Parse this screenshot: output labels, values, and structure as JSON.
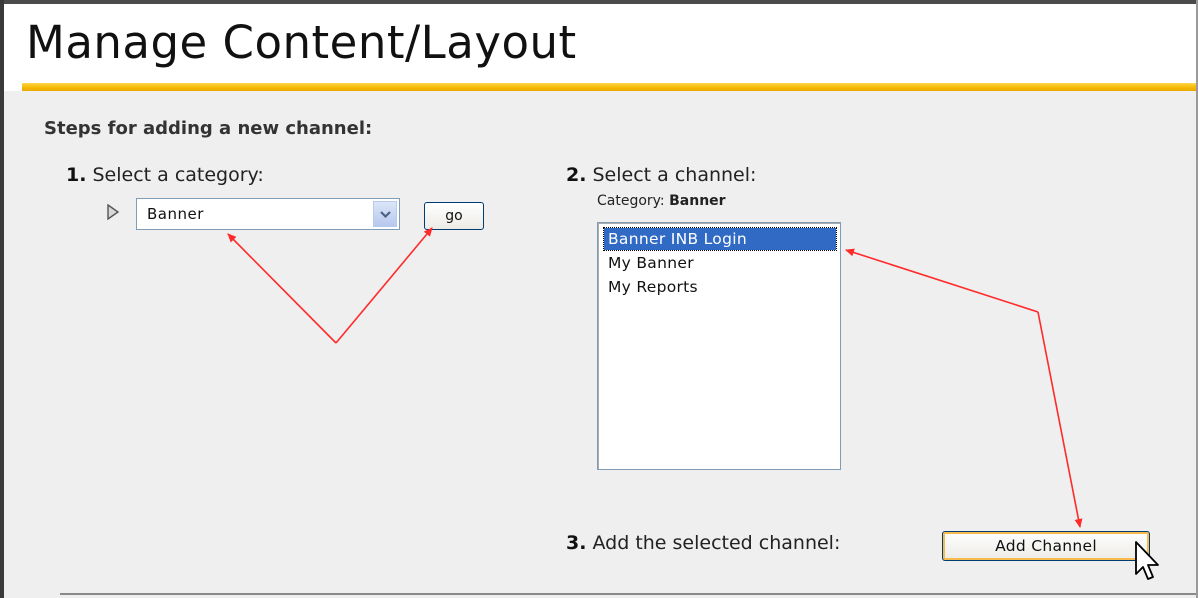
{
  "page": {
    "title": "Manage Content/Layout"
  },
  "steps": {
    "heading": "Steps for adding a new channel:",
    "step1": {
      "number": "1.",
      "label": " Select a category:",
      "category_select": {
        "value": "Banner"
      },
      "go_button": "go"
    },
    "step2": {
      "number": "2.",
      "label": " Select a channel:",
      "category_prefix": "Category: ",
      "category_name": "Banner",
      "channels": [
        {
          "label": "Banner INB Login",
          "selected": true
        },
        {
          "label": "My Banner",
          "selected": false
        },
        {
          "label": "My Reports",
          "selected": false
        }
      ]
    },
    "step3": {
      "number": "3.",
      "label": " Add the selected channel:",
      "add_button": "Add Channel"
    }
  },
  "icons": {
    "play": "play-triangle-icon",
    "dropdown": "chevron-down-icon",
    "cursor": "mouse-pointer-icon"
  },
  "colors": {
    "accent_gold": "#f4b800",
    "selection_blue": "#316ac5",
    "annotation_red": "#ff2a2a",
    "button_border": "#003c74"
  }
}
